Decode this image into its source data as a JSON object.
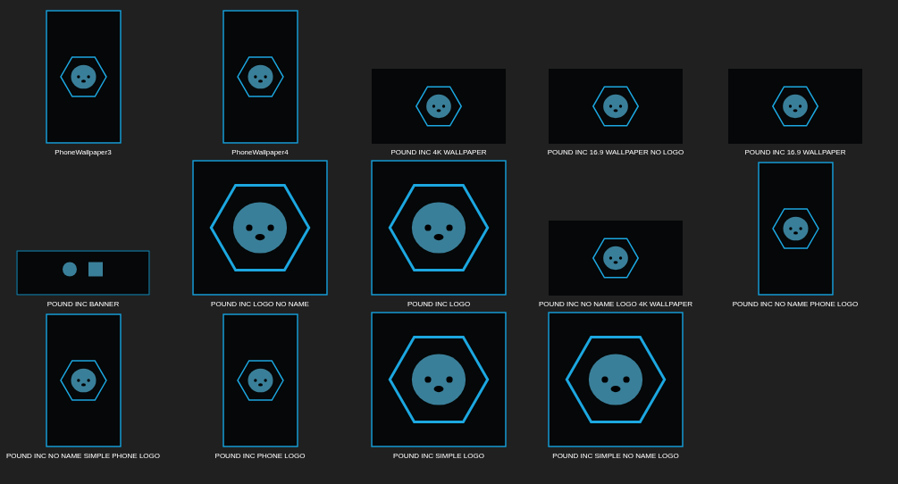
{
  "files": [
    {
      "name": "PhoneWallpaper3",
      "kind": "portrait"
    },
    {
      "name": "PhoneWallpaper4",
      "kind": "portrait"
    },
    {
      "name": "POUND INC 4K WALLPAPER",
      "kind": "landscape"
    },
    {
      "name": "POUND INC 16.9 WALLPAPER NO LOGO",
      "kind": "landscape"
    },
    {
      "name": "POUND INC 16.9 WALLPAPER",
      "kind": "landscape"
    },
    {
      "name": "POUND INC BANNER",
      "kind": "banner"
    },
    {
      "name": "POUND INC LOGO NO NAME",
      "kind": "square"
    },
    {
      "name": "POUND INC LOGO",
      "kind": "square"
    },
    {
      "name": "POUND INC NO NAME LOGO 4K WALLPAPER",
      "kind": "landscape"
    },
    {
      "name": "POUND INC NO NAME PHONE LOGO",
      "kind": "portrait"
    },
    {
      "name": "POUND INC NO NAME SIMPLE PHONE LOGO",
      "kind": "portrait"
    },
    {
      "name": "POUND INC PHONE LOGO",
      "kind": "portrait"
    },
    {
      "name": "POUND INC SIMPLE LOGO",
      "kind": "square"
    },
    {
      "name": "POUND INC SIMPLE NO NAME LOGO",
      "kind": "square"
    }
  ]
}
